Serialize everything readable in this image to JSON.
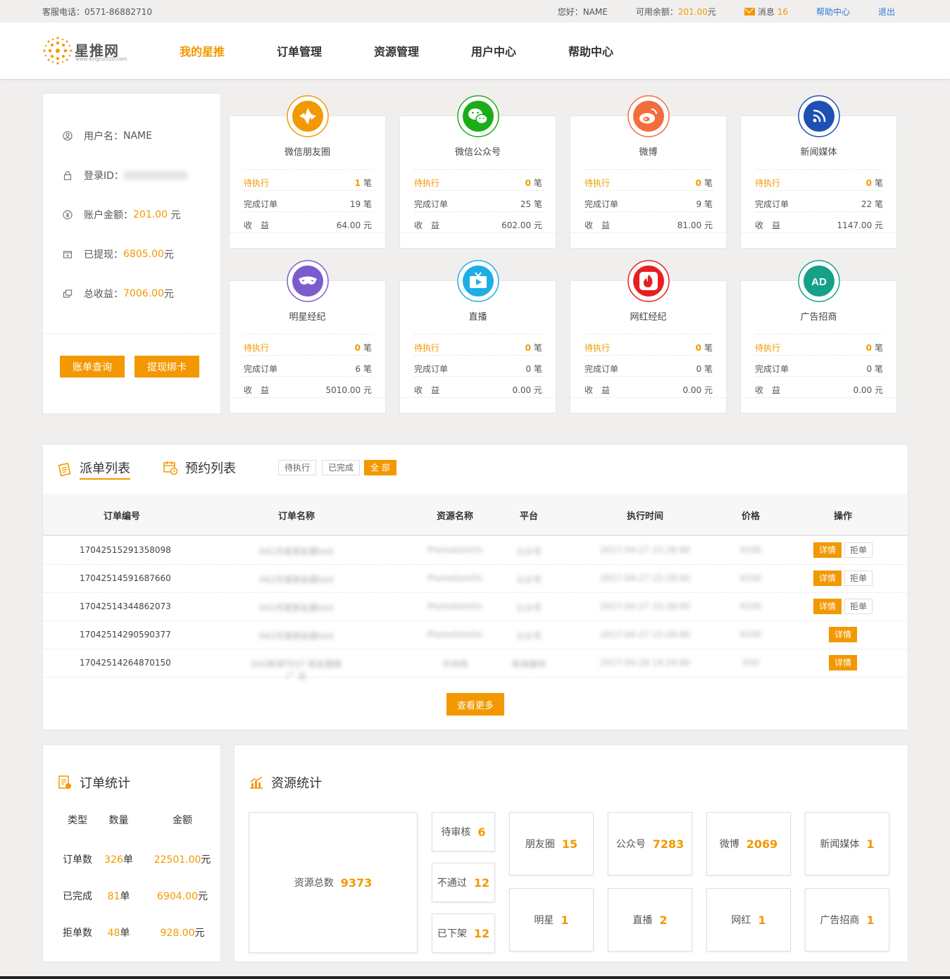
{
  "topbar": {
    "phone": "客服电话：0571-86882710",
    "greeting": "您好：NAME",
    "balance_label": "可用余额：",
    "balance_value": "201.00",
    "balance_unit": "元",
    "messages_label": "消息",
    "messages_count": "16",
    "help": "帮助中心",
    "logout": "退出"
  },
  "logo": {
    "name": "星推网",
    "url": "www.xingtui520.com"
  },
  "nav": [
    "我的星推",
    "订单管理",
    "资源管理",
    "用户中心",
    "帮助中心"
  ],
  "user": {
    "username_label": "用户名：",
    "username": "NAME",
    "login_label": "登录ID：",
    "balance_label": "账户金额：",
    "balance": "201.00",
    "withdrawn_label": "已提现：",
    "withdrawn": "6805.00",
    "income_label": "总收益：",
    "income": "7006.00",
    "unit": "元",
    "bill_btn": "账单查询",
    "card_btn": "提现绑卡"
  },
  "cat_labels": {
    "pending": "待执行",
    "done": "完成订单",
    "income": "收　益",
    "unit_count": "笔",
    "unit_money": "元"
  },
  "categories": [
    {
      "name": "微信朋友圈",
      "pending": "1",
      "done": "19",
      "income": "64.00",
      "icon": "wechat-moments-icon",
      "color": "#f39800"
    },
    {
      "name": "微信公众号",
      "pending": "0",
      "done": "25",
      "income": "602.00",
      "icon": "wechat-icon",
      "color": "#1aad19"
    },
    {
      "name": "微博",
      "pending": "0",
      "done": "9",
      "income": "81.00",
      "icon": "weibo-icon",
      "color": "#f26d3d"
    },
    {
      "name": "新闻媒体",
      "pending": "0",
      "done": "22",
      "income": "1147.00",
      "icon": "rss-icon",
      "color": "#1e50b4"
    },
    {
      "name": "明星经纪",
      "pending": "0",
      "done": "6",
      "income": "5010.00",
      "icon": "star-agent-icon",
      "color": "#7a5ccf"
    },
    {
      "name": "直播",
      "pending": "0",
      "done": "0",
      "income": "0.00",
      "icon": "live-tv-icon",
      "color": "#1eaee6"
    },
    {
      "name": "网红经纪",
      "pending": "0",
      "done": "0",
      "income": "0.00",
      "icon": "flame-icon",
      "color": "#e81f1f"
    },
    {
      "name": "广告招商",
      "pending": "0",
      "done": "0",
      "income": "0.00",
      "icon": "ad-icon",
      "color": "#15a187"
    }
  ],
  "orders": {
    "tab_dispatch": "派单列表",
    "tab_appoint": "预约列表",
    "filters": [
      "待执行",
      "已完成",
      "全 部"
    ],
    "columns": [
      "订单编号",
      "订单名称",
      "资源名称",
      "平台",
      "执行时间",
      "价格",
      "操作"
    ],
    "detail_label": "详情",
    "reject_label": "拒单",
    "more": "查看更多",
    "rows": [
      {
        "id": "17042515291358098",
        "name": "042月度朋友圈test",
        "resource": "PromotionOn",
        "platform": "公众号",
        "time": "2017-04-27 15:28:00",
        "price": "¥100",
        "reject": true
      },
      {
        "id": "17042514591687660",
        "name": "042月度朋友圈test",
        "resource": "PromotionOn",
        "platform": "公众号",
        "time": "2017-04-27 15:28:00",
        "price": "¥100",
        "reject": true
      },
      {
        "id": "17042514344862073",
        "name": "042月度朋友圈test",
        "resource": "PromotionOn",
        "platform": "公众号",
        "time": "2017-04-27 15:28:00",
        "price": "¥100",
        "reject": true
      },
      {
        "id": "17042514290590377",
        "name": "042月度朋友圈test",
        "resource": "PromotionOn",
        "platform": "公众号",
        "time": "2017-04-27 15:28:00",
        "price": "¥100",
        "reject": false
      },
      {
        "id": "17042514264870150",
        "name": "042新闻TEST 朋友圈推广 全",
        "resource": "中央网",
        "platform": "新闻媒体",
        "time": "2017-04-28 14:24:00",
        "price": "¥50",
        "reject": false
      }
    ]
  },
  "order_stats": {
    "title": "订单统计",
    "headers": [
      "类型",
      "数量",
      "金额"
    ],
    "rows": [
      {
        "type": "订单数",
        "count": "326",
        "amount": "22501.00"
      },
      {
        "type": "已完成",
        "count": "81",
        "amount": "6904.00"
      },
      {
        "type": "拒单数",
        "count": "48",
        "amount": "928.00"
      }
    ],
    "count_unit": "单",
    "amount_unit": "元"
  },
  "resource_stats": {
    "title": "资源统计",
    "total_label": "资源总数",
    "total": "9373",
    "status": [
      {
        "label": "待审核",
        "value": "6"
      },
      {
        "label": "不通过",
        "value": "12"
      },
      {
        "label": "已下架",
        "value": "12"
      }
    ],
    "types": [
      {
        "label": "朋友圈",
        "value": "15"
      },
      {
        "label": "公众号",
        "value": "7283"
      },
      {
        "label": "微博",
        "value": "2069"
      },
      {
        "label": "新闻媒体",
        "value": "1"
      },
      {
        "label": "明星",
        "value": "1"
      },
      {
        "label": "直播",
        "value": "2"
      },
      {
        "label": "网红",
        "value": "1"
      },
      {
        "label": "广告招商",
        "value": "1"
      }
    ]
  }
}
